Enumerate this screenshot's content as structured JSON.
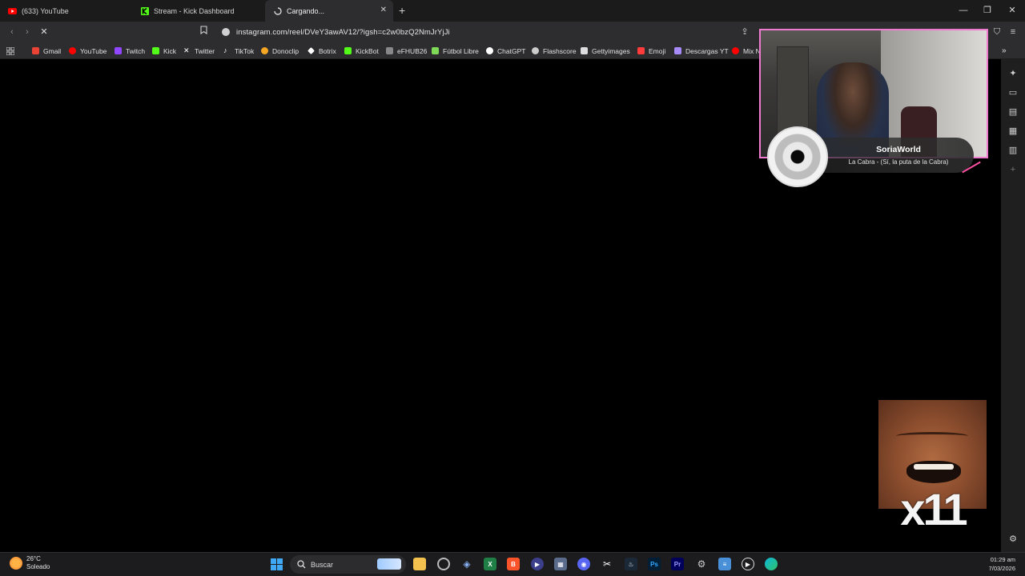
{
  "tabs": [
    {
      "title": "(633) YouTube",
      "icon": "youtube-icon",
      "color": "#ff0000"
    },
    {
      "title": "Stream - Kick Dashboard",
      "icon": "kick-icon",
      "color": "#53fc18"
    },
    {
      "title": "Cargando...",
      "icon": "loading-spinner-icon",
      "active": true
    }
  ],
  "address": {
    "url": "instagram.com/reel/DVeY3awAV12/?igsh=c2w0bzQ2NmJrYjJi"
  },
  "bookmarks": [
    {
      "label": "Gmail",
      "icon": "gmail-icon",
      "color": "#ea4335"
    },
    {
      "label": "YouTube",
      "icon": "youtube-icon",
      "color": "#ff0000"
    },
    {
      "label": "Twitch",
      "icon": "twitch-icon",
      "color": "#9146ff"
    },
    {
      "label": "Kick",
      "icon": "kick-icon",
      "color": "#53fc18"
    },
    {
      "label": "Twitter",
      "icon": "x-icon",
      "color": "#ffffff"
    },
    {
      "label": "TikTok",
      "icon": "tiktok-icon",
      "color": "#ffffff"
    },
    {
      "label": "Donoclip",
      "icon": "donoclip-icon",
      "color": "#f5a623"
    },
    {
      "label": "Botrix",
      "icon": "botrix-icon",
      "color": "#ffffff"
    },
    {
      "label": "KickBot",
      "icon": "kickbot-icon",
      "color": "#53fc18"
    },
    {
      "label": "eFHUB26",
      "icon": "efhub-icon",
      "color": "#ffffff"
    },
    {
      "label": "Fútbol Libre",
      "icon": "futbol-icon",
      "color": "#7ed957"
    },
    {
      "label": "ChatGPT",
      "icon": "chatgpt-icon",
      "color": "#ffffff"
    },
    {
      "label": "Flashscore",
      "icon": "flashscore-icon",
      "color": "#ffffff"
    },
    {
      "label": "Gettyimages",
      "icon": "getty-icon",
      "color": "#ffffff"
    },
    {
      "label": "Emoji",
      "icon": "emoji-icon",
      "color": "#ff3b3b"
    },
    {
      "label": "Descargas YT",
      "icon": "descargas-icon",
      "color": "#a78bfa"
    },
    {
      "label": "Mix N",
      "icon": "youtube-icon",
      "color": "#ff0000"
    }
  ],
  "overlay": {
    "streamer": "SoriaWorld",
    "song": "La Cabra - (Sí, la puta de la Cabra)",
    "multiplier": "x11",
    "border_color": "#f07ad0"
  },
  "taskbar": {
    "weather_temp": "26°C",
    "weather_desc": "Soleado",
    "search_placeholder": "Buscar",
    "time": "01:29 am",
    "date": "7/03/2026"
  }
}
